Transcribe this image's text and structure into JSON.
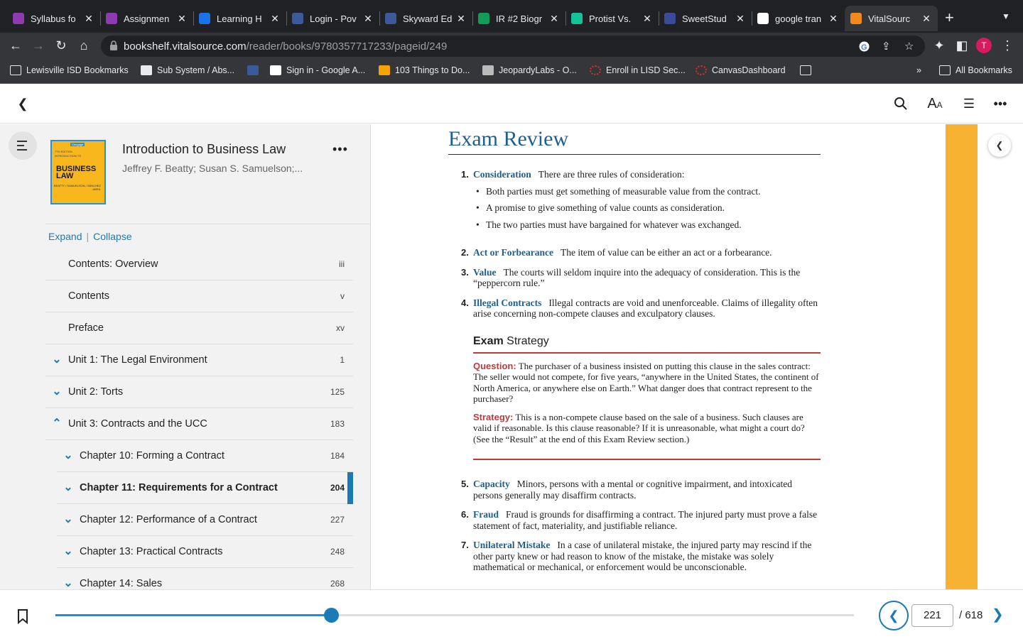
{
  "browser": {
    "tabs": [
      {
        "label": "Syllabus fo",
        "color": "#8e3bb0"
      },
      {
        "label": "Assignmen",
        "color": "#8e3bb0"
      },
      {
        "label": "Learning H",
        "color": "#1a73e8"
      },
      {
        "label": "Login - Pov",
        "color": "#3c5a99"
      },
      {
        "label": "Skyward Ed",
        "color": "#3c5a99"
      },
      {
        "label": "IR #2 Biogr",
        "color": "#0f9d58"
      },
      {
        "label": "Protist Vs.",
        "color": "#15c39a"
      },
      {
        "label": "SweetStud",
        "color": "#3c4a9a"
      },
      {
        "label": "google tran",
        "color": "#ffffff"
      },
      {
        "label": "VitalSourc",
        "color": "#f08a1c"
      }
    ],
    "url_domain": "bookshelf.vitalsource.com",
    "url_path": "/reader/books/9780357717233/pageid/249",
    "profile_initial": "T",
    "bookmarks": [
      "Lewisville ISD Bookmarks",
      "Sub System / Abs...",
      "",
      "Sign in - Google A...",
      "103 Things to Do...",
      "JeopardyLabs - O...",
      "Enroll in LISD Sec...",
      "CanvasDashboard",
      ""
    ],
    "bookmarks_more": "»",
    "all_bookmarks": "All Bookmarks"
  },
  "book": {
    "title": "Introduction to Business Law",
    "authors": "Jeffrey F. Beatty; Susan S. Samuelson;...",
    "cover": {
      "edition": "7TH EDITION",
      "publisher": "Cengage",
      "title_line1": "BUSINESS",
      "title_line2": "LAW",
      "authors": "BEATTY / SAMUELSON / SÁNCHEZ ABRIL",
      "small": "INTRODUCTION TO"
    }
  },
  "toc": {
    "expand": "Expand",
    "sep": "|",
    "collapse": "Collapse",
    "entries": [
      {
        "label": "Contents: Overview",
        "page": "iii",
        "chevron": ""
      },
      {
        "label": "Contents",
        "page": "v",
        "chevron": ""
      },
      {
        "label": "Preface",
        "page": "xv",
        "chevron": ""
      },
      {
        "label": "Unit 1: The Legal Environment",
        "page": "1",
        "chevron": "down"
      },
      {
        "label": "Unit 2: Torts",
        "page": "125",
        "chevron": "down"
      },
      {
        "label": "Unit 3: Contracts and the UCC",
        "page": "183",
        "chevron": "up"
      },
      {
        "label": "Chapter 10: Forming a Contract",
        "page": "184",
        "chevron": "down"
      },
      {
        "label": "Chapter 11: Requirements for a Contract",
        "page": "204",
        "chevron": "down"
      },
      {
        "label": "Chapter 12: Performance of a Contract",
        "page": "227",
        "chevron": "down"
      },
      {
        "label": "Chapter 13: Practical Contracts",
        "page": "248",
        "chevron": "down"
      },
      {
        "label": "Chapter 14: Sales",
        "page": "268",
        "chevron": "down"
      }
    ]
  },
  "page": {
    "heading": "Exam Review",
    "items": [
      {
        "num": "1.",
        "term": "Consideration",
        "text": "There are three rules of consideration:",
        "bullets": [
          "Both parties must get something of measurable value from the contract.",
          "A promise to give something of value counts as consideration.",
          "The two parties must have bargained for whatever was exchanged."
        ]
      },
      {
        "num": "2.",
        "term": "Act or Forbearance",
        "text": "The item of value can be either an act or a forbearance."
      },
      {
        "num": "3.",
        "term": "Value",
        "text": "The courts will seldom inquire into the adequacy of consideration. This is the “peppercorn rule.”"
      },
      {
        "num": "4.",
        "term": "Illegal Contracts",
        "text": "Illegal contracts are void and unenforceable. Claims of illegality often arise concerning non-compete clauses and exculpatory clauses."
      }
    ],
    "strategy": {
      "title_bold": "Exam",
      "title_rest": "Strategy",
      "question_label": "Question:",
      "question": "The purchaser of a business insisted on putting this clause in the sales contract: The seller would not compete, for five years, “anywhere in the United States, the continent of North America, or anywhere else on Earth.” What danger does that contract represent to the purchaser?",
      "strategy_label": "Strategy:",
      "strategy_text": "This is a non-compete clause based on the sale of a business. Such clauses are valid if reasonable. Is this clause reasonable? If it is unreasonable, what might a court do? (See the “Result” at the end of this Exam Review section.)"
    },
    "items2": [
      {
        "num": "5.",
        "term": "Capacity",
        "text": "Minors, persons with a mental or cognitive impairment, and intoxicated persons generally may disaffirm contracts."
      },
      {
        "num": "6.",
        "term": "Fraud",
        "text": "Fraud is grounds for disaffirming a contract. The injured party must prove a false statement of fact, materiality, and justifiable reliance."
      },
      {
        "num": "7.",
        "term": "Unilateral Mistake",
        "text": "In a case of unilateral mistake, the injured party may rescind if the other party knew or had reason to know of the mistake, the mistake was solely mathematical or mechanical, or enforcement would be unconscionable."
      }
    ]
  },
  "footer": {
    "current_page": "221",
    "total": "/ 618",
    "progress": 0.345
  },
  "colors": {
    "accent": "#1a7bb5",
    "heading": "#1f5e8e",
    "strategy_red": "#c0393b",
    "side_orange": "#f8b231"
  }
}
